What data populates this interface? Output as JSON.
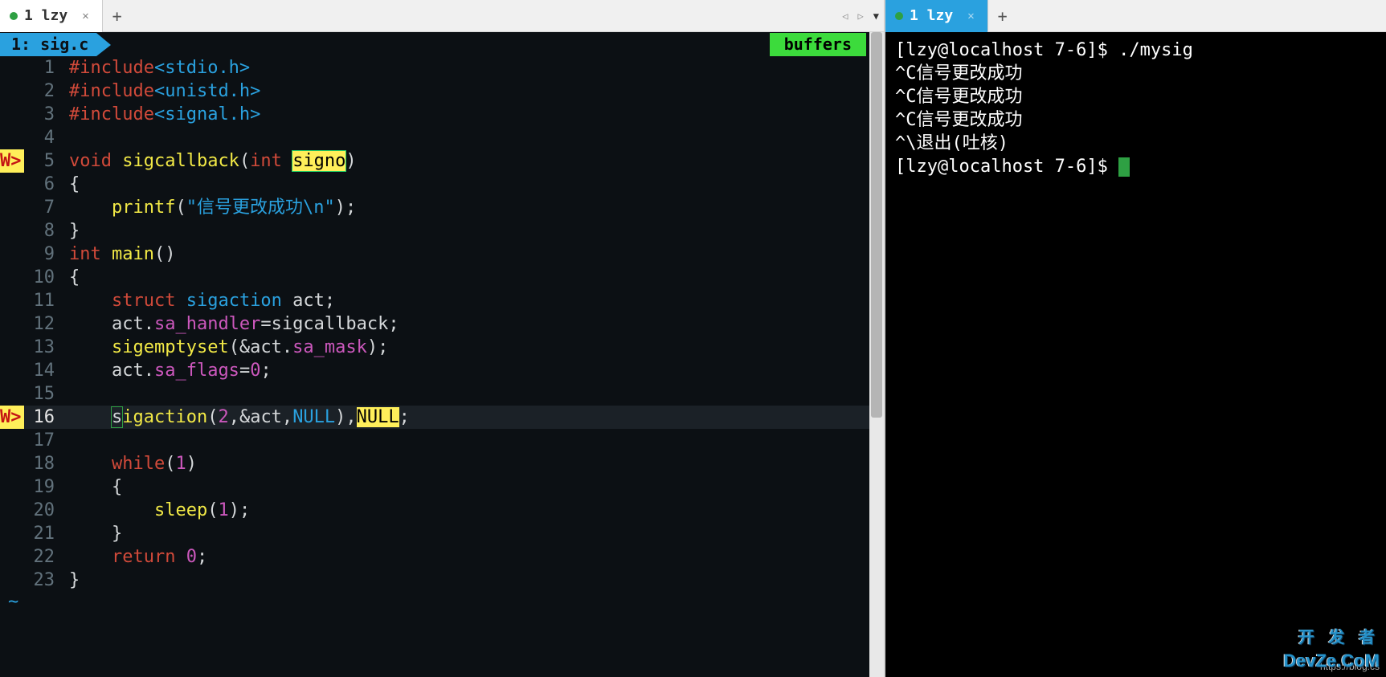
{
  "left": {
    "tab": {
      "label": "1 lzy"
    },
    "file_tag": "1: sig.c",
    "buffers_label": "buffers",
    "code": {
      "rows": [
        {
          "n": 1,
          "mark": "",
          "tokens": [
            {
              "c": "kw",
              "t": "#include"
            },
            {
              "c": "type",
              "t": "<stdio.h>"
            }
          ]
        },
        {
          "n": 2,
          "mark": "",
          "tokens": [
            {
              "c": "kw",
              "t": "#include"
            },
            {
              "c": "type",
              "t": "<unistd.h>"
            }
          ]
        },
        {
          "n": 3,
          "mark": "",
          "tokens": [
            {
              "c": "kw",
              "t": "#include"
            },
            {
              "c": "type",
              "t": "<signal.h>"
            }
          ]
        },
        {
          "n": 4,
          "mark": "",
          "tokens": []
        },
        {
          "n": 5,
          "mark": "W>",
          "tokens": [
            {
              "c": "kw",
              "t": "void"
            },
            {
              "c": "plain",
              "t": " "
            },
            {
              "c": "fn",
              "t": "sigcallback"
            },
            {
              "c": "plain",
              "t": "("
            },
            {
              "c": "kw",
              "t": "int"
            },
            {
              "c": "plain",
              "t": " "
            },
            {
              "c": "hl-box",
              "t": "signo"
            },
            {
              "c": "plain",
              "t": ")"
            }
          ]
        },
        {
          "n": 6,
          "mark": "",
          "tokens": [
            {
              "c": "plain",
              "t": "{"
            }
          ]
        },
        {
          "n": 7,
          "mark": "",
          "tokens": [
            {
              "c": "plain",
              "t": "    "
            },
            {
              "c": "fn",
              "t": "printf"
            },
            {
              "c": "plain",
              "t": "("
            },
            {
              "c": "str",
              "t": "\"信号更改成功\\n\""
            },
            {
              "c": "plain",
              "t": ");"
            }
          ]
        },
        {
          "n": 8,
          "mark": "",
          "tokens": [
            {
              "c": "plain",
              "t": "}"
            }
          ]
        },
        {
          "n": 9,
          "mark": "",
          "tokens": [
            {
              "c": "kw",
              "t": "int"
            },
            {
              "c": "plain",
              "t": " "
            },
            {
              "c": "fn",
              "t": "main"
            },
            {
              "c": "plain",
              "t": "()"
            }
          ]
        },
        {
          "n": 10,
          "mark": "",
          "tokens": [
            {
              "c": "plain",
              "t": "{"
            }
          ]
        },
        {
          "n": 11,
          "mark": "",
          "tokens": [
            {
              "c": "plain",
              "t": "    "
            },
            {
              "c": "kw",
              "t": "struct"
            },
            {
              "c": "plain",
              "t": " "
            },
            {
              "c": "type",
              "t": "sigaction"
            },
            {
              "c": "plain",
              "t": " act;"
            }
          ]
        },
        {
          "n": 12,
          "mark": "",
          "tokens": [
            {
              "c": "plain",
              "t": "    act."
            },
            {
              "c": "field",
              "t": "sa_handler"
            },
            {
              "c": "plain",
              "t": "=sigcallback;"
            }
          ]
        },
        {
          "n": 13,
          "mark": "",
          "tokens": [
            {
              "c": "plain",
              "t": "    "
            },
            {
              "c": "fn",
              "t": "sigemptyset"
            },
            {
              "c": "plain",
              "t": "(&act."
            },
            {
              "c": "field",
              "t": "sa_mask"
            },
            {
              "c": "plain",
              "t": ");"
            }
          ]
        },
        {
          "n": 14,
          "mark": "",
          "tokens": [
            {
              "c": "plain",
              "t": "    act."
            },
            {
              "c": "field",
              "t": "sa_flags"
            },
            {
              "c": "plain",
              "t": "="
            },
            {
              "c": "num",
              "t": "0"
            },
            {
              "c": "plain",
              "t": ";"
            }
          ]
        },
        {
          "n": 15,
          "mark": "",
          "tokens": []
        },
        {
          "n": 16,
          "mark": "W>",
          "cur": true,
          "tokens": [
            {
              "c": "plain",
              "t": "    "
            },
            {
              "c": "curbox",
              "t": "s"
            },
            {
              "c": "fn",
              "t": "igaction"
            },
            {
              "c": "plain",
              "t": "("
            },
            {
              "c": "num",
              "t": "2"
            },
            {
              "c": "plain",
              "t": ",&act,"
            },
            {
              "c": "type",
              "t": "NULL"
            },
            {
              "c": "plain",
              "t": "),"
            },
            {
              "c": "hl-null",
              "t": "NULL"
            },
            {
              "c": "plain",
              "t": ";"
            }
          ]
        },
        {
          "n": 17,
          "mark": "",
          "tokens": []
        },
        {
          "n": 18,
          "mark": "",
          "tokens": [
            {
              "c": "plain",
              "t": "    "
            },
            {
              "c": "kw",
              "t": "while"
            },
            {
              "c": "plain",
              "t": "("
            },
            {
              "c": "num",
              "t": "1"
            },
            {
              "c": "plain",
              "t": ")"
            }
          ]
        },
        {
          "n": 19,
          "mark": "",
          "tokens": [
            {
              "c": "plain",
              "t": "    {"
            }
          ]
        },
        {
          "n": 20,
          "mark": "",
          "tokens": [
            {
              "c": "plain",
              "t": "        "
            },
            {
              "c": "fn",
              "t": "sleep"
            },
            {
              "c": "plain",
              "t": "("
            },
            {
              "c": "num",
              "t": "1"
            },
            {
              "c": "plain",
              "t": ");"
            }
          ]
        },
        {
          "n": 21,
          "mark": "",
          "tokens": [
            {
              "c": "plain",
              "t": "    }"
            }
          ]
        },
        {
          "n": 22,
          "mark": "",
          "tokens": [
            {
              "c": "plain",
              "t": "    "
            },
            {
              "c": "kw",
              "t": "return"
            },
            {
              "c": "plain",
              "t": " "
            },
            {
              "c": "num",
              "t": "0"
            },
            {
              "c": "plain",
              "t": ";"
            }
          ]
        },
        {
          "n": 23,
          "mark": "",
          "tokens": [
            {
              "c": "plain",
              "t": "}"
            }
          ]
        }
      ]
    },
    "tilde": "~"
  },
  "right": {
    "tab": {
      "label": "1 lzy"
    },
    "terminal": [
      "[lzy@localhost 7-6]$ ./mysig",
      "^C信号更改成功",
      "^C信号更改成功",
      "^C信号更改成功",
      "^\\退出(吐核)",
      "[lzy@localhost 7-6]$ "
    ]
  },
  "watermark_url": "https://blog.cs",
  "watermark_logo": "开发者\nDevZe.CoM"
}
